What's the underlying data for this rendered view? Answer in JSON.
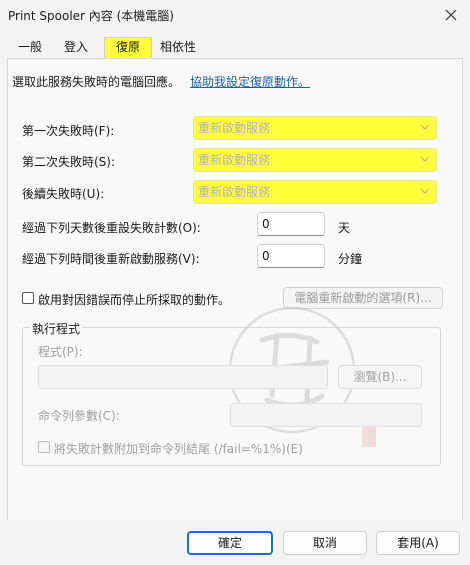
{
  "window": {
    "title": "Print Spooler 內容 (本機電腦)"
  },
  "tabs": [
    {
      "label": "一般"
    },
    {
      "label": "登入"
    },
    {
      "label": "復原",
      "selected": true
    },
    {
      "label": "相依性"
    }
  ],
  "recovery": {
    "description": "選取此服務失敗時的電腦回應。",
    "help_link": "協助我設定復原動作。",
    "first_failure": {
      "label": "第一次失敗時(F):",
      "value": "重新啟動服務"
    },
    "second_failure": {
      "label": "第二次失敗時(S):",
      "value": "重新啟動服務"
    },
    "subsequent_failures": {
      "label": "後續失敗時(U):",
      "value": "重新啟動服務"
    },
    "reset_days": {
      "label": "經過下列天數後重設失敗計數(O):",
      "value": "0",
      "unit": "天"
    },
    "restart_minutes": {
      "label": "經過下列時間後重新啟動服務(V):",
      "value": "0",
      "unit": "分鐘"
    },
    "enable_actions": {
      "label": "啟用對因錯誤而停止所採取的動作。",
      "checked": false
    },
    "reboot_options_button": "電腦重新啟動的選項(R)...",
    "run_program": {
      "group_title": "執行程式",
      "program_label": "程式(P):",
      "program_value": "",
      "browse_button": "瀏覽(B)...",
      "params_label": "命令列參數(C):",
      "params_value": "",
      "append_label": "將失敗計數附加到命令列結尾 (/fail=%1%)(E)",
      "append_checked": false
    }
  },
  "footer": {
    "ok": "確定",
    "cancel": "取消",
    "apply": "套用(A)"
  },
  "colors": {
    "highlight": "#ffff3a",
    "link": "#1a5fb4",
    "focus": "#1a6fd0"
  },
  "icons": {
    "close": "close-icon",
    "dropdown": "chevron-down-icon",
    "watermark": "stamp-watermark"
  }
}
